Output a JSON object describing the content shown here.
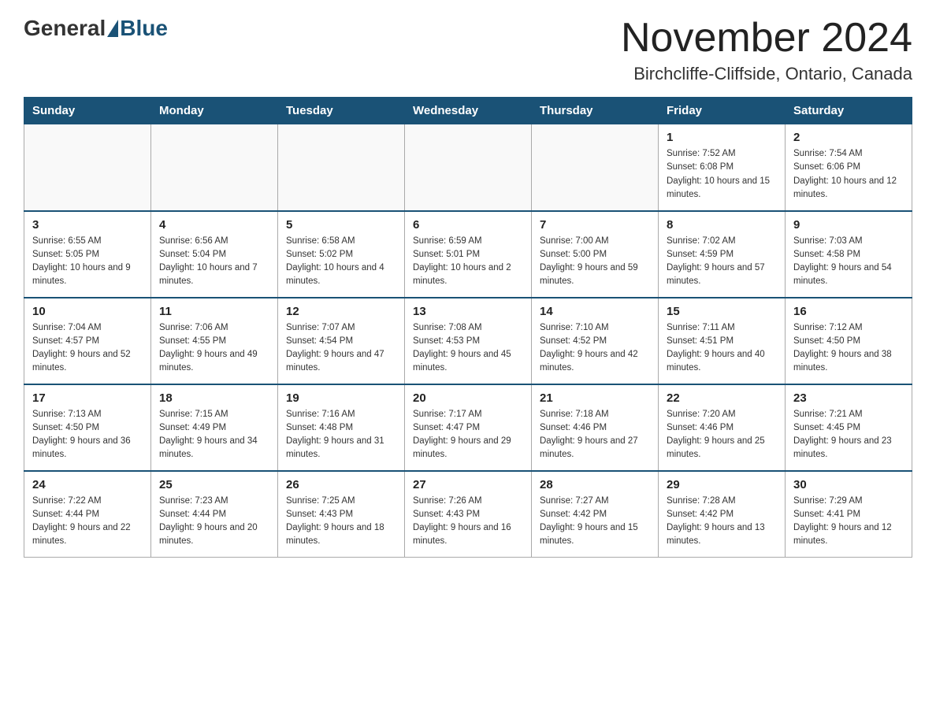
{
  "header": {
    "logo_general": "General",
    "logo_blue": "Blue",
    "month_title": "November 2024",
    "location": "Birchcliffe-Cliffside, Ontario, Canada"
  },
  "weekdays": [
    "Sunday",
    "Monday",
    "Tuesday",
    "Wednesday",
    "Thursday",
    "Friday",
    "Saturday"
  ],
  "weeks": [
    [
      {
        "day": "",
        "sunrise": "",
        "sunset": "",
        "daylight": ""
      },
      {
        "day": "",
        "sunrise": "",
        "sunset": "",
        "daylight": ""
      },
      {
        "day": "",
        "sunrise": "",
        "sunset": "",
        "daylight": ""
      },
      {
        "day": "",
        "sunrise": "",
        "sunset": "",
        "daylight": ""
      },
      {
        "day": "",
        "sunrise": "",
        "sunset": "",
        "daylight": ""
      },
      {
        "day": "1",
        "sunrise": "Sunrise: 7:52 AM",
        "sunset": "Sunset: 6:08 PM",
        "daylight": "Daylight: 10 hours and 15 minutes."
      },
      {
        "day": "2",
        "sunrise": "Sunrise: 7:54 AM",
        "sunset": "Sunset: 6:06 PM",
        "daylight": "Daylight: 10 hours and 12 minutes."
      }
    ],
    [
      {
        "day": "3",
        "sunrise": "Sunrise: 6:55 AM",
        "sunset": "Sunset: 5:05 PM",
        "daylight": "Daylight: 10 hours and 9 minutes."
      },
      {
        "day": "4",
        "sunrise": "Sunrise: 6:56 AM",
        "sunset": "Sunset: 5:04 PM",
        "daylight": "Daylight: 10 hours and 7 minutes."
      },
      {
        "day": "5",
        "sunrise": "Sunrise: 6:58 AM",
        "sunset": "Sunset: 5:02 PM",
        "daylight": "Daylight: 10 hours and 4 minutes."
      },
      {
        "day": "6",
        "sunrise": "Sunrise: 6:59 AM",
        "sunset": "Sunset: 5:01 PM",
        "daylight": "Daylight: 10 hours and 2 minutes."
      },
      {
        "day": "7",
        "sunrise": "Sunrise: 7:00 AM",
        "sunset": "Sunset: 5:00 PM",
        "daylight": "Daylight: 9 hours and 59 minutes."
      },
      {
        "day": "8",
        "sunrise": "Sunrise: 7:02 AM",
        "sunset": "Sunset: 4:59 PM",
        "daylight": "Daylight: 9 hours and 57 minutes."
      },
      {
        "day": "9",
        "sunrise": "Sunrise: 7:03 AM",
        "sunset": "Sunset: 4:58 PM",
        "daylight": "Daylight: 9 hours and 54 minutes."
      }
    ],
    [
      {
        "day": "10",
        "sunrise": "Sunrise: 7:04 AM",
        "sunset": "Sunset: 4:57 PM",
        "daylight": "Daylight: 9 hours and 52 minutes."
      },
      {
        "day": "11",
        "sunrise": "Sunrise: 7:06 AM",
        "sunset": "Sunset: 4:55 PM",
        "daylight": "Daylight: 9 hours and 49 minutes."
      },
      {
        "day": "12",
        "sunrise": "Sunrise: 7:07 AM",
        "sunset": "Sunset: 4:54 PM",
        "daylight": "Daylight: 9 hours and 47 minutes."
      },
      {
        "day": "13",
        "sunrise": "Sunrise: 7:08 AM",
        "sunset": "Sunset: 4:53 PM",
        "daylight": "Daylight: 9 hours and 45 minutes."
      },
      {
        "day": "14",
        "sunrise": "Sunrise: 7:10 AM",
        "sunset": "Sunset: 4:52 PM",
        "daylight": "Daylight: 9 hours and 42 minutes."
      },
      {
        "day": "15",
        "sunrise": "Sunrise: 7:11 AM",
        "sunset": "Sunset: 4:51 PM",
        "daylight": "Daylight: 9 hours and 40 minutes."
      },
      {
        "day": "16",
        "sunrise": "Sunrise: 7:12 AM",
        "sunset": "Sunset: 4:50 PM",
        "daylight": "Daylight: 9 hours and 38 minutes."
      }
    ],
    [
      {
        "day": "17",
        "sunrise": "Sunrise: 7:13 AM",
        "sunset": "Sunset: 4:50 PM",
        "daylight": "Daylight: 9 hours and 36 minutes."
      },
      {
        "day": "18",
        "sunrise": "Sunrise: 7:15 AM",
        "sunset": "Sunset: 4:49 PM",
        "daylight": "Daylight: 9 hours and 34 minutes."
      },
      {
        "day": "19",
        "sunrise": "Sunrise: 7:16 AM",
        "sunset": "Sunset: 4:48 PM",
        "daylight": "Daylight: 9 hours and 31 minutes."
      },
      {
        "day": "20",
        "sunrise": "Sunrise: 7:17 AM",
        "sunset": "Sunset: 4:47 PM",
        "daylight": "Daylight: 9 hours and 29 minutes."
      },
      {
        "day": "21",
        "sunrise": "Sunrise: 7:18 AM",
        "sunset": "Sunset: 4:46 PM",
        "daylight": "Daylight: 9 hours and 27 minutes."
      },
      {
        "day": "22",
        "sunrise": "Sunrise: 7:20 AM",
        "sunset": "Sunset: 4:46 PM",
        "daylight": "Daylight: 9 hours and 25 minutes."
      },
      {
        "day": "23",
        "sunrise": "Sunrise: 7:21 AM",
        "sunset": "Sunset: 4:45 PM",
        "daylight": "Daylight: 9 hours and 23 minutes."
      }
    ],
    [
      {
        "day": "24",
        "sunrise": "Sunrise: 7:22 AM",
        "sunset": "Sunset: 4:44 PM",
        "daylight": "Daylight: 9 hours and 22 minutes."
      },
      {
        "day": "25",
        "sunrise": "Sunrise: 7:23 AM",
        "sunset": "Sunset: 4:44 PM",
        "daylight": "Daylight: 9 hours and 20 minutes."
      },
      {
        "day": "26",
        "sunrise": "Sunrise: 7:25 AM",
        "sunset": "Sunset: 4:43 PM",
        "daylight": "Daylight: 9 hours and 18 minutes."
      },
      {
        "day": "27",
        "sunrise": "Sunrise: 7:26 AM",
        "sunset": "Sunset: 4:43 PM",
        "daylight": "Daylight: 9 hours and 16 minutes."
      },
      {
        "day": "28",
        "sunrise": "Sunrise: 7:27 AM",
        "sunset": "Sunset: 4:42 PM",
        "daylight": "Daylight: 9 hours and 15 minutes."
      },
      {
        "day": "29",
        "sunrise": "Sunrise: 7:28 AM",
        "sunset": "Sunset: 4:42 PM",
        "daylight": "Daylight: 9 hours and 13 minutes."
      },
      {
        "day": "30",
        "sunrise": "Sunrise: 7:29 AM",
        "sunset": "Sunset: 4:41 PM",
        "daylight": "Daylight: 9 hours and 12 minutes."
      }
    ]
  ]
}
